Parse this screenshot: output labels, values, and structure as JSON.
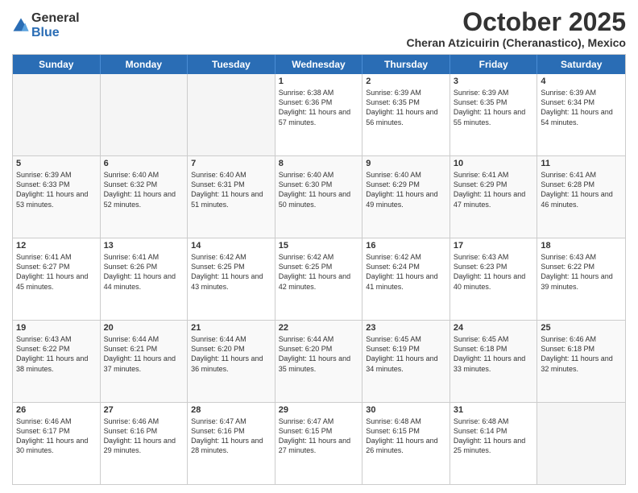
{
  "logo": {
    "general": "General",
    "blue": "Blue"
  },
  "header": {
    "month": "October 2025",
    "location": "Cheran Atzicuirin (Cheranastico), Mexico"
  },
  "days_of_week": [
    "Sunday",
    "Monday",
    "Tuesday",
    "Wednesday",
    "Thursday",
    "Friday",
    "Saturday"
  ],
  "weeks": [
    [
      {
        "day": "",
        "info": ""
      },
      {
        "day": "",
        "info": ""
      },
      {
        "day": "",
        "info": ""
      },
      {
        "day": "1",
        "info": "Sunrise: 6:38 AM\nSunset: 6:36 PM\nDaylight: 11 hours and 57 minutes."
      },
      {
        "day": "2",
        "info": "Sunrise: 6:39 AM\nSunset: 6:35 PM\nDaylight: 11 hours and 56 minutes."
      },
      {
        "day": "3",
        "info": "Sunrise: 6:39 AM\nSunset: 6:35 PM\nDaylight: 11 hours and 55 minutes."
      },
      {
        "day": "4",
        "info": "Sunrise: 6:39 AM\nSunset: 6:34 PM\nDaylight: 11 hours and 54 minutes."
      }
    ],
    [
      {
        "day": "5",
        "info": "Sunrise: 6:39 AM\nSunset: 6:33 PM\nDaylight: 11 hours and 53 minutes."
      },
      {
        "day": "6",
        "info": "Sunrise: 6:40 AM\nSunset: 6:32 PM\nDaylight: 11 hours and 52 minutes."
      },
      {
        "day": "7",
        "info": "Sunrise: 6:40 AM\nSunset: 6:31 PM\nDaylight: 11 hours and 51 minutes."
      },
      {
        "day": "8",
        "info": "Sunrise: 6:40 AM\nSunset: 6:30 PM\nDaylight: 11 hours and 50 minutes."
      },
      {
        "day": "9",
        "info": "Sunrise: 6:40 AM\nSunset: 6:29 PM\nDaylight: 11 hours and 49 minutes."
      },
      {
        "day": "10",
        "info": "Sunrise: 6:41 AM\nSunset: 6:29 PM\nDaylight: 11 hours and 47 minutes."
      },
      {
        "day": "11",
        "info": "Sunrise: 6:41 AM\nSunset: 6:28 PM\nDaylight: 11 hours and 46 minutes."
      }
    ],
    [
      {
        "day": "12",
        "info": "Sunrise: 6:41 AM\nSunset: 6:27 PM\nDaylight: 11 hours and 45 minutes."
      },
      {
        "day": "13",
        "info": "Sunrise: 6:41 AM\nSunset: 6:26 PM\nDaylight: 11 hours and 44 minutes."
      },
      {
        "day": "14",
        "info": "Sunrise: 6:42 AM\nSunset: 6:25 PM\nDaylight: 11 hours and 43 minutes."
      },
      {
        "day": "15",
        "info": "Sunrise: 6:42 AM\nSunset: 6:25 PM\nDaylight: 11 hours and 42 minutes."
      },
      {
        "day": "16",
        "info": "Sunrise: 6:42 AM\nSunset: 6:24 PM\nDaylight: 11 hours and 41 minutes."
      },
      {
        "day": "17",
        "info": "Sunrise: 6:43 AM\nSunset: 6:23 PM\nDaylight: 11 hours and 40 minutes."
      },
      {
        "day": "18",
        "info": "Sunrise: 6:43 AM\nSunset: 6:22 PM\nDaylight: 11 hours and 39 minutes."
      }
    ],
    [
      {
        "day": "19",
        "info": "Sunrise: 6:43 AM\nSunset: 6:22 PM\nDaylight: 11 hours and 38 minutes."
      },
      {
        "day": "20",
        "info": "Sunrise: 6:44 AM\nSunset: 6:21 PM\nDaylight: 11 hours and 37 minutes."
      },
      {
        "day": "21",
        "info": "Sunrise: 6:44 AM\nSunset: 6:20 PM\nDaylight: 11 hours and 36 minutes."
      },
      {
        "day": "22",
        "info": "Sunrise: 6:44 AM\nSunset: 6:20 PM\nDaylight: 11 hours and 35 minutes."
      },
      {
        "day": "23",
        "info": "Sunrise: 6:45 AM\nSunset: 6:19 PM\nDaylight: 11 hours and 34 minutes."
      },
      {
        "day": "24",
        "info": "Sunrise: 6:45 AM\nSunset: 6:18 PM\nDaylight: 11 hours and 33 minutes."
      },
      {
        "day": "25",
        "info": "Sunrise: 6:46 AM\nSunset: 6:18 PM\nDaylight: 11 hours and 32 minutes."
      }
    ],
    [
      {
        "day": "26",
        "info": "Sunrise: 6:46 AM\nSunset: 6:17 PM\nDaylight: 11 hours and 30 minutes."
      },
      {
        "day": "27",
        "info": "Sunrise: 6:46 AM\nSunset: 6:16 PM\nDaylight: 11 hours and 29 minutes."
      },
      {
        "day": "28",
        "info": "Sunrise: 6:47 AM\nSunset: 6:16 PM\nDaylight: 11 hours and 28 minutes."
      },
      {
        "day": "29",
        "info": "Sunrise: 6:47 AM\nSunset: 6:15 PM\nDaylight: 11 hours and 27 minutes."
      },
      {
        "day": "30",
        "info": "Sunrise: 6:48 AM\nSunset: 6:15 PM\nDaylight: 11 hours and 26 minutes."
      },
      {
        "day": "31",
        "info": "Sunrise: 6:48 AM\nSunset: 6:14 PM\nDaylight: 11 hours and 25 minutes."
      },
      {
        "day": "",
        "info": ""
      }
    ]
  ]
}
